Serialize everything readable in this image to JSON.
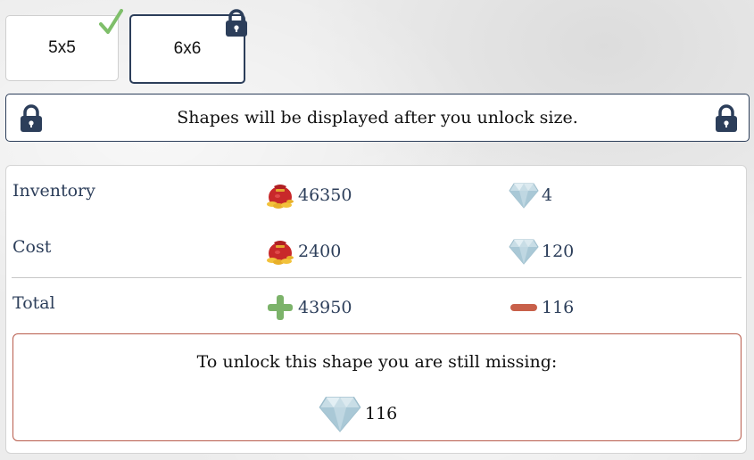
{
  "sizes": [
    {
      "label": "5x5",
      "status": "completed"
    },
    {
      "label": "6x6",
      "status": "locked",
      "selected": true
    }
  ],
  "notice": {
    "text": "Shapes will be displayed after you unlock size."
  },
  "resources": {
    "inventory": {
      "label": "Inventory",
      "gold": "46350",
      "gems": "4"
    },
    "cost": {
      "label": "Cost",
      "gold": "2400",
      "gems": "120"
    },
    "total": {
      "label": "Total",
      "gold": "43950",
      "gems": "116",
      "gold_sign": "plus",
      "gems_sign": "minus"
    }
  },
  "missing": {
    "title": "To unlock this shape you are still missing:",
    "gems": "116"
  },
  "colors": {
    "accent": "#2c3e5a",
    "check": "#7fbf6a",
    "plus": "#7cb36a",
    "minus": "#c8604a",
    "missing_border": "#b85c4c"
  },
  "icons": {
    "gold": "gold-bag-icon",
    "gem": "diamond-icon",
    "lock": "padlock-icon",
    "check": "checkmark-icon",
    "plus": "plus-icon",
    "minus": "minus-icon"
  }
}
